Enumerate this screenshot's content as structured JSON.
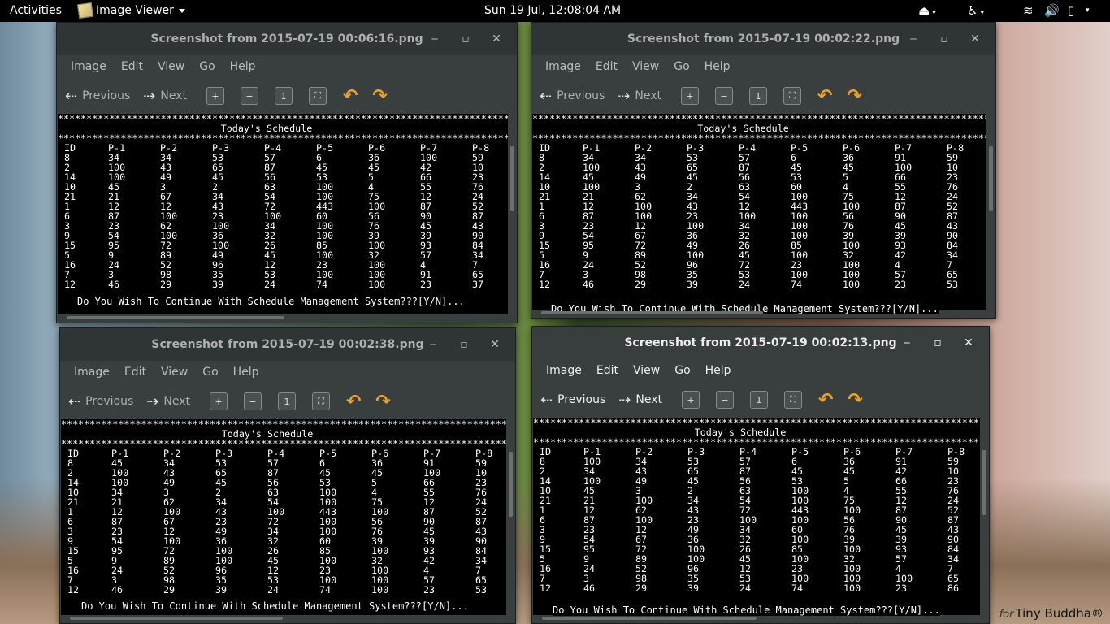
{
  "topbar": {
    "activities": "Activities",
    "app_menu": "Image Viewer",
    "clock": "Sun 19 Jul, 12:08:04 AM"
  },
  "menus": [
    "Image",
    "Edit",
    "View",
    "Go",
    "Help"
  ],
  "toolbar": {
    "previous": "Previous",
    "next": "Next"
  },
  "schedule_title": "Today's Schedule",
  "headers": [
    "ID",
    "P-1",
    "P-2",
    "P-3",
    "P-4",
    "P-5",
    "P-6",
    "P-7",
    "P-8"
  ],
  "prompt": "Do You Wish To Continue With Schedule Management System???[Y/N]...",
  "windows": [
    {
      "title": "Screenshot from 2015-07-19 00:06:16.png",
      "rows": [
        [
          "8",
          "34",
          "34",
          "53",
          "57",
          "6",
          "36",
          "100",
          "59"
        ],
        [
          "2",
          "100",
          "43",
          "65",
          "87",
          "45",
          "45",
          "42",
          "10"
        ],
        [
          "14",
          "100",
          "49",
          "45",
          "56",
          "53",
          "5",
          "66",
          "23"
        ],
        [
          "10",
          "45",
          "3",
          "2",
          "63",
          "100",
          "4",
          "55",
          "76"
        ],
        [
          "21",
          "21",
          "67",
          "34",
          "54",
          "100",
          "75",
          "12",
          "24"
        ],
        [
          "1",
          "12",
          "12",
          "43",
          "72",
          "443",
          "100",
          "87",
          "52"
        ],
        [
          "6",
          "87",
          "100",
          "23",
          "100",
          "60",
          "56",
          "90",
          "87"
        ],
        [
          "3",
          "23",
          "62",
          "100",
          "34",
          "100",
          "76",
          "45",
          "43"
        ],
        [
          "9",
          "54",
          "100",
          "36",
          "32",
          "100",
          "39",
          "39",
          "90"
        ],
        [
          "15",
          "95",
          "72",
          "100",
          "26",
          "85",
          "100",
          "93",
          "84"
        ],
        [
          "5",
          "9",
          "89",
          "49",
          "45",
          "100",
          "32",
          "57",
          "34"
        ],
        [
          "16",
          "24",
          "52",
          "96",
          "12",
          "23",
          "100",
          "4",
          "7"
        ],
        [
          "7",
          "3",
          "98",
          "35",
          "53",
          "100",
          "100",
          "91",
          "65"
        ],
        [
          "12",
          "46",
          "29",
          "39",
          "24",
          "74",
          "100",
          "23",
          "37"
        ]
      ]
    },
    {
      "title": "Screenshot from 2015-07-19 00:02:22.png",
      "rows": [
        [
          "8",
          "34",
          "34",
          "53",
          "57",
          "6",
          "36",
          "91",
          "59"
        ],
        [
          "2",
          "100",
          "43",
          "65",
          "87",
          "45",
          "45",
          "100",
          "10"
        ],
        [
          "14",
          "45",
          "49",
          "45",
          "56",
          "53",
          "5",
          "66",
          "23"
        ],
        [
          "10",
          "100",
          "3",
          "2",
          "63",
          "60",
          "4",
          "55",
          "76"
        ],
        [
          "21",
          "21",
          "62",
          "34",
          "54",
          "100",
          "75",
          "12",
          "24"
        ],
        [
          "1",
          "12",
          "100",
          "43",
          "12",
          "443",
          "100",
          "87",
          "52"
        ],
        [
          "6",
          "87",
          "100",
          "23",
          "100",
          "100",
          "56",
          "90",
          "87"
        ],
        [
          "3",
          "23",
          "12",
          "100",
          "34",
          "100",
          "76",
          "45",
          "43"
        ],
        [
          "9",
          "54",
          "67",
          "36",
          "32",
          "100",
          "39",
          "39",
          "90"
        ],
        [
          "15",
          "95",
          "72",
          "49",
          "26",
          "85",
          "100",
          "93",
          "84"
        ],
        [
          "5",
          "9",
          "89",
          "100",
          "45",
          "100",
          "32",
          "42",
          "34"
        ],
        [
          "16",
          "24",
          "52",
          "96",
          "72",
          "23",
          "100",
          "4",
          "7"
        ],
        [
          "7",
          "3",
          "98",
          "35",
          "53",
          "100",
          "100",
          "57",
          "65"
        ],
        [
          "12",
          "46",
          "29",
          "39",
          "24",
          "74",
          "100",
          "23",
          "53"
        ]
      ]
    },
    {
      "title": "Screenshot from 2015-07-19 00:02:38.png",
      "rows": [
        [
          "8",
          "45",
          "34",
          "53",
          "57",
          "6",
          "36",
          "91",
          "59"
        ],
        [
          "2",
          "100",
          "43",
          "65",
          "87",
          "45",
          "45",
          "100",
          "10"
        ],
        [
          "14",
          "100",
          "49",
          "45",
          "56",
          "53",
          "5",
          "66",
          "23"
        ],
        [
          "10",
          "34",
          "3",
          "2",
          "63",
          "100",
          "4",
          "55",
          "76"
        ],
        [
          "21",
          "21",
          "62",
          "34",
          "54",
          "100",
          "75",
          "12",
          "24"
        ],
        [
          "1",
          "12",
          "100",
          "43",
          "100",
          "443",
          "100",
          "87",
          "52"
        ],
        [
          "6",
          "87",
          "67",
          "23",
          "72",
          "100",
          "56",
          "90",
          "87"
        ],
        [
          "3",
          "23",
          "12",
          "49",
          "34",
          "100",
          "76",
          "45",
          "43"
        ],
        [
          "9",
          "54",
          "100",
          "36",
          "32",
          "60",
          "39",
          "39",
          "90"
        ],
        [
          "15",
          "95",
          "72",
          "100",
          "26",
          "85",
          "100",
          "93",
          "84"
        ],
        [
          "5",
          "9",
          "89",
          "100",
          "45",
          "100",
          "32",
          "42",
          "34"
        ],
        [
          "16",
          "24",
          "52",
          "96",
          "12",
          "23",
          "100",
          "4",
          "7"
        ],
        [
          "7",
          "3",
          "98",
          "35",
          "53",
          "100",
          "100",
          "57",
          "65"
        ],
        [
          "12",
          "46",
          "29",
          "39",
          "24",
          "74",
          "100",
          "23",
          "53"
        ]
      ]
    },
    {
      "title": "Screenshot from 2015-07-19 00:02:13.png",
      "rows": [
        [
          "8",
          "100",
          "34",
          "53",
          "57",
          "6",
          "36",
          "91",
          "59"
        ],
        [
          "2",
          "34",
          "43",
          "65",
          "87",
          "45",
          "45",
          "42",
          "10"
        ],
        [
          "14",
          "100",
          "49",
          "45",
          "56",
          "53",
          "5",
          "66",
          "23"
        ],
        [
          "10",
          "45",
          "3",
          "2",
          "63",
          "100",
          "4",
          "55",
          "76"
        ],
        [
          "21",
          "21",
          "100",
          "34",
          "54",
          "100",
          "75",
          "12",
          "24"
        ],
        [
          "1",
          "12",
          "62",
          "43",
          "72",
          "443",
          "100",
          "87",
          "52"
        ],
        [
          "6",
          "87",
          "100",
          "23",
          "100",
          "100",
          "56",
          "90",
          "87"
        ],
        [
          "3",
          "23",
          "12",
          "49",
          "34",
          "60",
          "76",
          "45",
          "43"
        ],
        [
          "9",
          "54",
          "67",
          "36",
          "32",
          "100",
          "39",
          "39",
          "90"
        ],
        [
          "15",
          "95",
          "72",
          "100",
          "26",
          "85",
          "100",
          "93",
          "84"
        ],
        [
          "5",
          "9",
          "89",
          "100",
          "45",
          "100",
          "32",
          "57",
          "34"
        ],
        [
          "16",
          "24",
          "52",
          "96",
          "12",
          "23",
          "100",
          "4",
          "7"
        ],
        [
          "7",
          "3",
          "98",
          "35",
          "53",
          "100",
          "100",
          "100",
          "65"
        ],
        [
          "12",
          "46",
          "29",
          "39",
          "24",
          "74",
          "100",
          "23",
          "86"
        ]
      ]
    }
  ],
  "watermark": {
    "for": "for",
    "brand": "Tiny Buddha®"
  }
}
